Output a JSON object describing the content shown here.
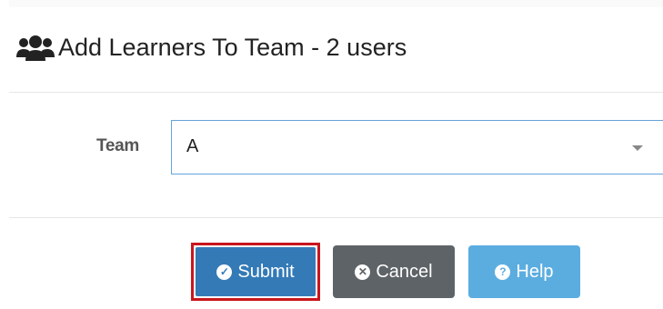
{
  "modal": {
    "title": "Add Learners To Team - 2 users",
    "icon": "users-icon"
  },
  "form": {
    "team_label": "Team",
    "team_value": "A"
  },
  "footer": {
    "submit_label": "Submit",
    "cancel_label": "Cancel",
    "help_label": "Help"
  },
  "colors": {
    "primary": "#337ab7",
    "cancel": "#5e6367",
    "help": "#5bade0",
    "highlight": "#c9161d"
  }
}
